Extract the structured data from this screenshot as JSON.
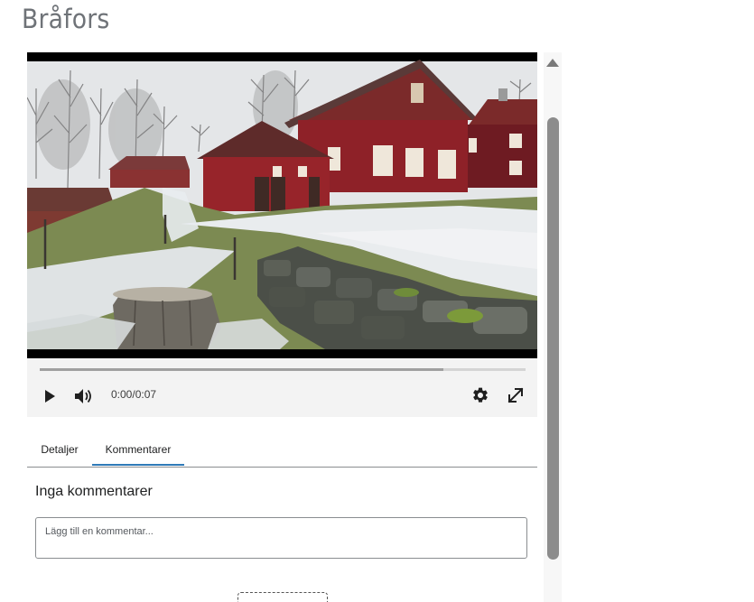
{
  "page": {
    "title": "Bråfors"
  },
  "player": {
    "time": "0:00/0:07",
    "buffered_fraction": 0.83,
    "icons": {
      "play": "play-icon",
      "volume": "volume-icon",
      "settings": "gear-icon",
      "fullscreen": "fullscreen-icon"
    }
  },
  "tabs": [
    {
      "label": "Detaljer",
      "active": false
    },
    {
      "label": "Kommentarer",
      "active": true
    }
  ],
  "comments": {
    "empty_text": "Inga kommentarer",
    "input_placeholder": "Lägg till en kommentar...",
    "input_value": ""
  },
  "colors": {
    "accent": "#2f7ab8",
    "barn_red": "#8e2128",
    "control_bar": "#f3f3f3",
    "title_gray": "#6f7378"
  }
}
